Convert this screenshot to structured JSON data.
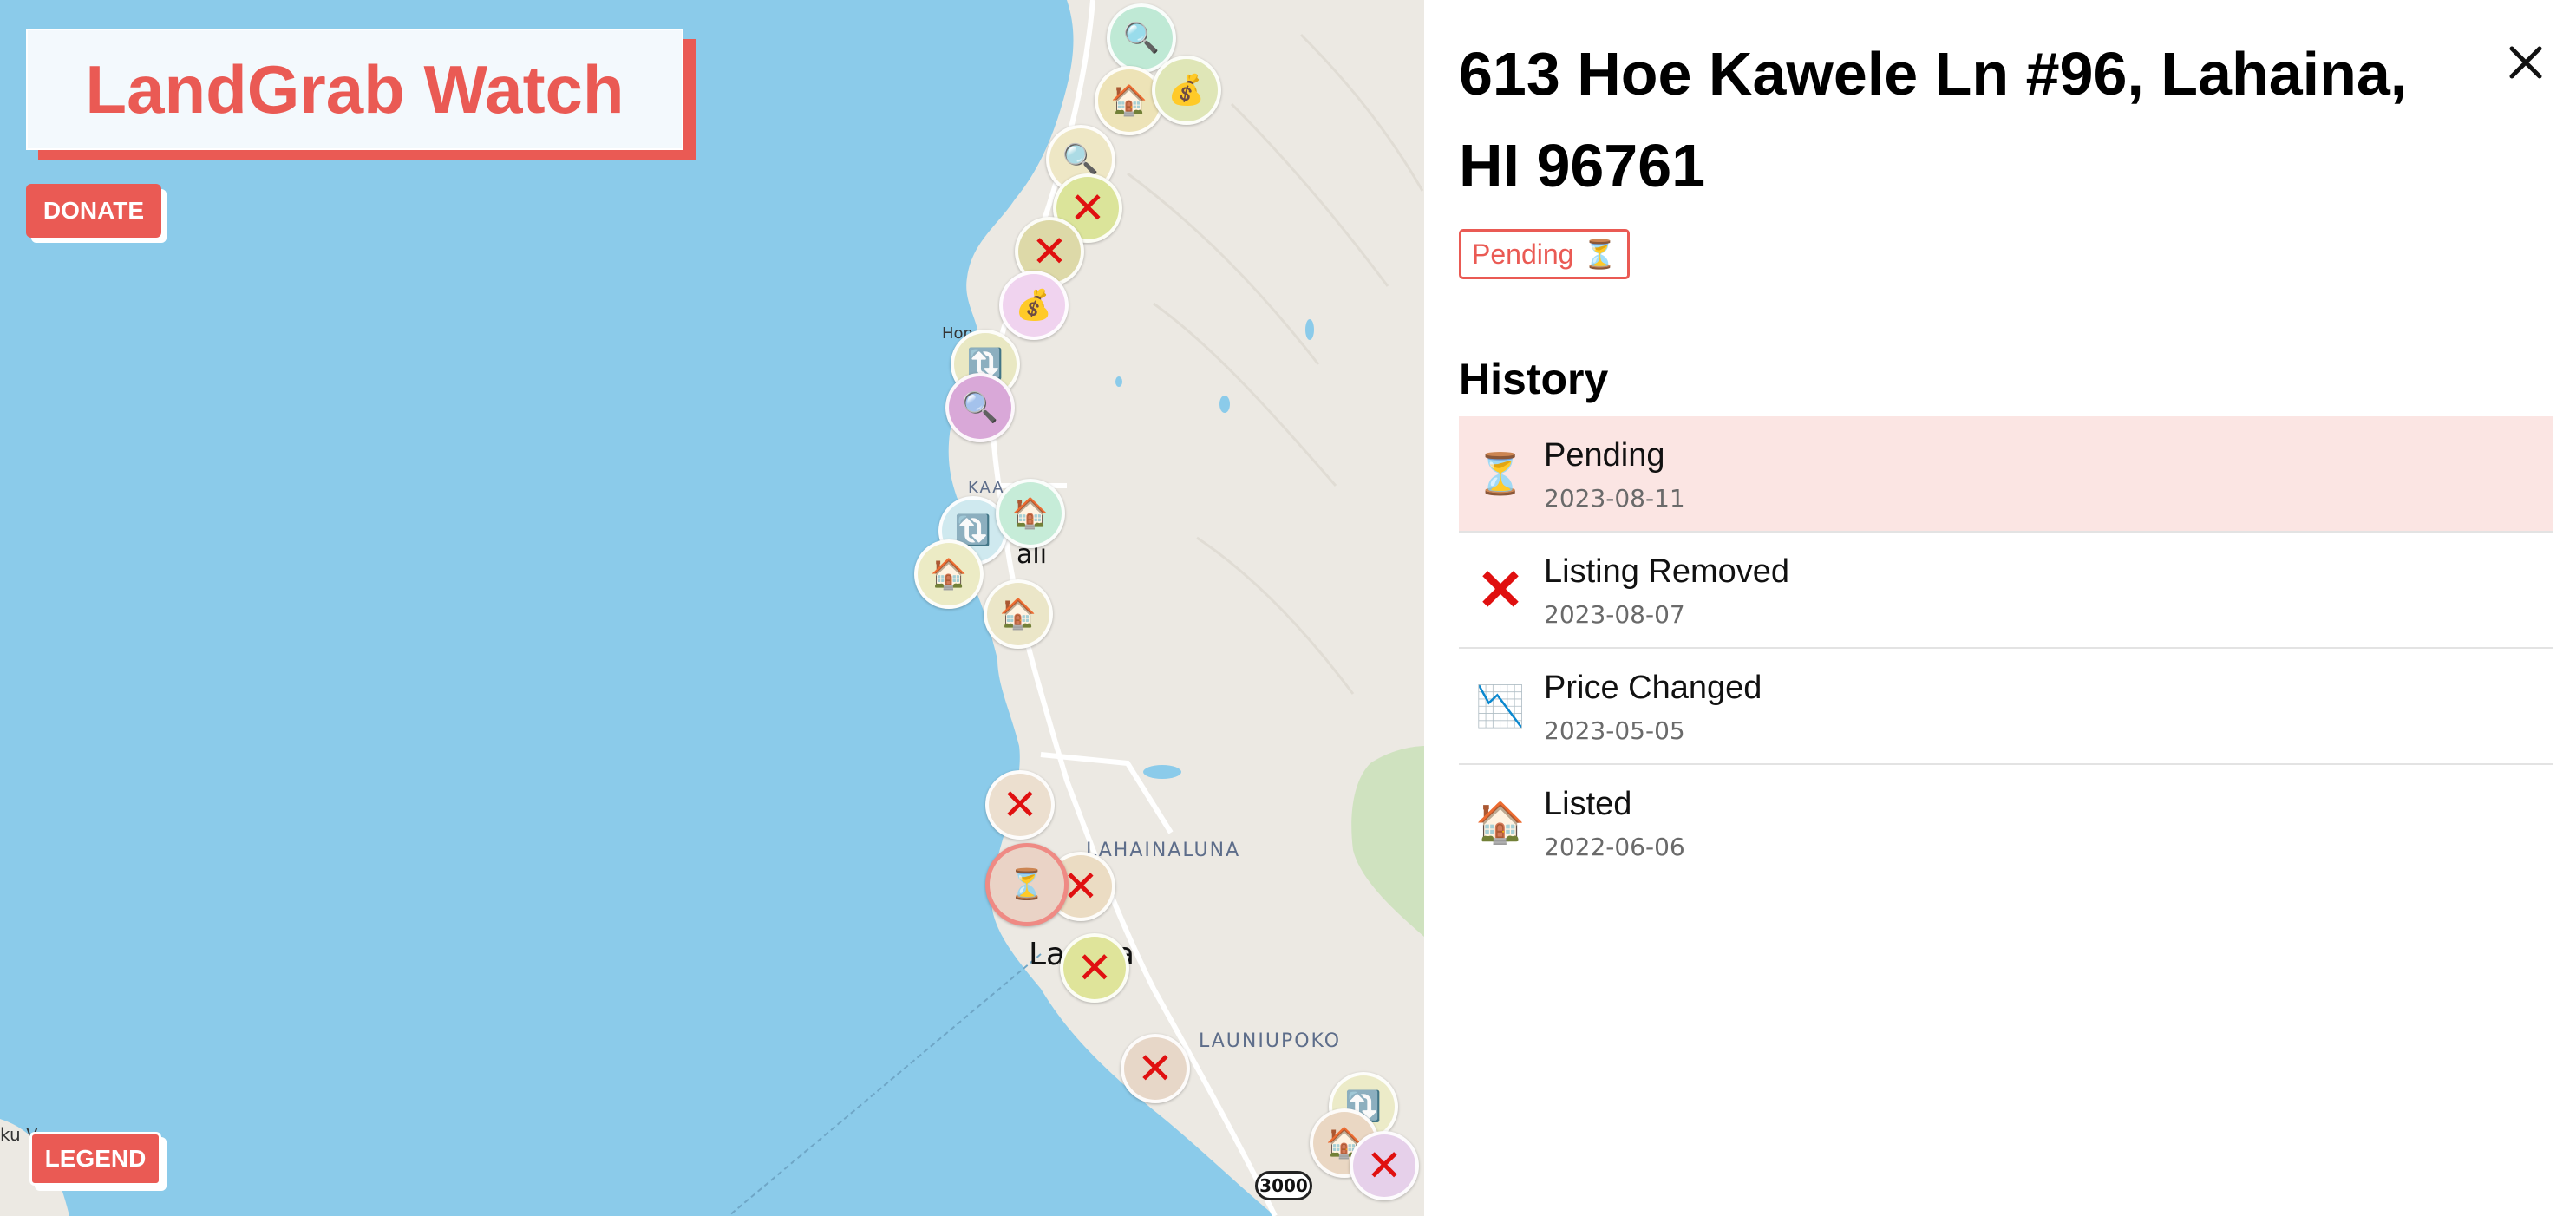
{
  "app": {
    "title": "LandGrab Watch",
    "donate_label": "DONATE",
    "legend_label": "LEGEND"
  },
  "colors": {
    "brand": "#ea5a54",
    "ocean": "#8bcbea",
    "land": "#ece9e3",
    "active_row": "#fbe5e3"
  },
  "map": {
    "labels": {
      "lahainaluna": "LAHAINALUNA",
      "launiupoko": "LAUNIUPOKO",
      "kaanapali_partial": "KAA",
      "honokowai_partial": "Hon",
      "lahaina_town": "La",
      "lahaina_town_2": "a",
      "pali": "ali",
      "attribution": "ku V"
    },
    "route_shield": "3000",
    "markers": [
      {
        "icon": "magnifier-icon",
        "glyph": "🔍",
        "color": "#bfe9d5"
      },
      {
        "icon": "house-icon",
        "glyph": "🏠",
        "color": "#ede3b7"
      },
      {
        "icon": "money-bag-icon",
        "glyph": "💰",
        "color": "#dfe6b7"
      },
      {
        "icon": "magnifier-icon",
        "glyph": "🔍",
        "color": "#eee7c5"
      },
      {
        "icon": "cross-icon",
        "glyph": "✕",
        "color": "#dbe49a"
      },
      {
        "icon": "cross-icon",
        "glyph": "✕",
        "color": "#ddd9a8"
      },
      {
        "icon": "money-bag-icon",
        "glyph": "💰",
        "color": "#f0d3ef"
      },
      {
        "icon": "refresh-icon",
        "glyph": "🔃",
        "color": "#e9e8c3"
      },
      {
        "icon": "magnifier-icon",
        "glyph": "🔍",
        "color": "#d9a8d8"
      },
      {
        "icon": "refresh-icon",
        "glyph": "🔃",
        "color": "#cfe9ef"
      },
      {
        "icon": "house-icon",
        "glyph": "🏠",
        "color": "#c6ecd8"
      },
      {
        "icon": "house-icon",
        "glyph": "🏠",
        "color": "#ecebc5"
      },
      {
        "icon": "house-icon",
        "glyph": "🏠",
        "color": "#ebe6c8"
      },
      {
        "icon": "cross-icon",
        "glyph": "✕",
        "color": "#ecdfcf"
      },
      {
        "icon": "hourglass-icon",
        "glyph": "⏳",
        "color": "#ead3c6"
      },
      {
        "icon": "cross-icon",
        "glyph": "✕",
        "color": "#ebdcc3"
      },
      {
        "icon": "cross-icon",
        "glyph": "✕",
        "color": "#dfe49a"
      },
      {
        "icon": "cross-icon",
        "glyph": "✕",
        "color": "#e7d7c8"
      },
      {
        "icon": "refresh-icon",
        "glyph": "🔃",
        "color": "#ecebc8"
      },
      {
        "icon": "house-icon",
        "glyph": "🏠",
        "color": "#ead7c3"
      },
      {
        "icon": "cross-icon",
        "glyph": "✕",
        "color": "#e6d0ea"
      }
    ]
  },
  "panel": {
    "address": "613 Hoe Kawele Ln #96, Lahaina, HI 96761",
    "status": {
      "label": "Pending",
      "icon": "hourglass-icon",
      "glyph": "⏳"
    },
    "history_title": "History",
    "history": [
      {
        "label": "Pending",
        "date": "2023-08-11",
        "icon": "hourglass-icon",
        "glyph": "⏳",
        "active": true
      },
      {
        "label": "Listing Removed",
        "date": "2023-08-07",
        "icon": "cross-icon",
        "glyph": "✕",
        "active": false
      },
      {
        "label": "Price Changed",
        "date": "2023-05-05",
        "icon": "chart-decreasing-icon",
        "glyph": "📉",
        "active": false
      },
      {
        "label": "Listed",
        "date": "2022-06-06",
        "icon": "house-icon",
        "glyph": "🏠",
        "active": false
      }
    ]
  }
}
